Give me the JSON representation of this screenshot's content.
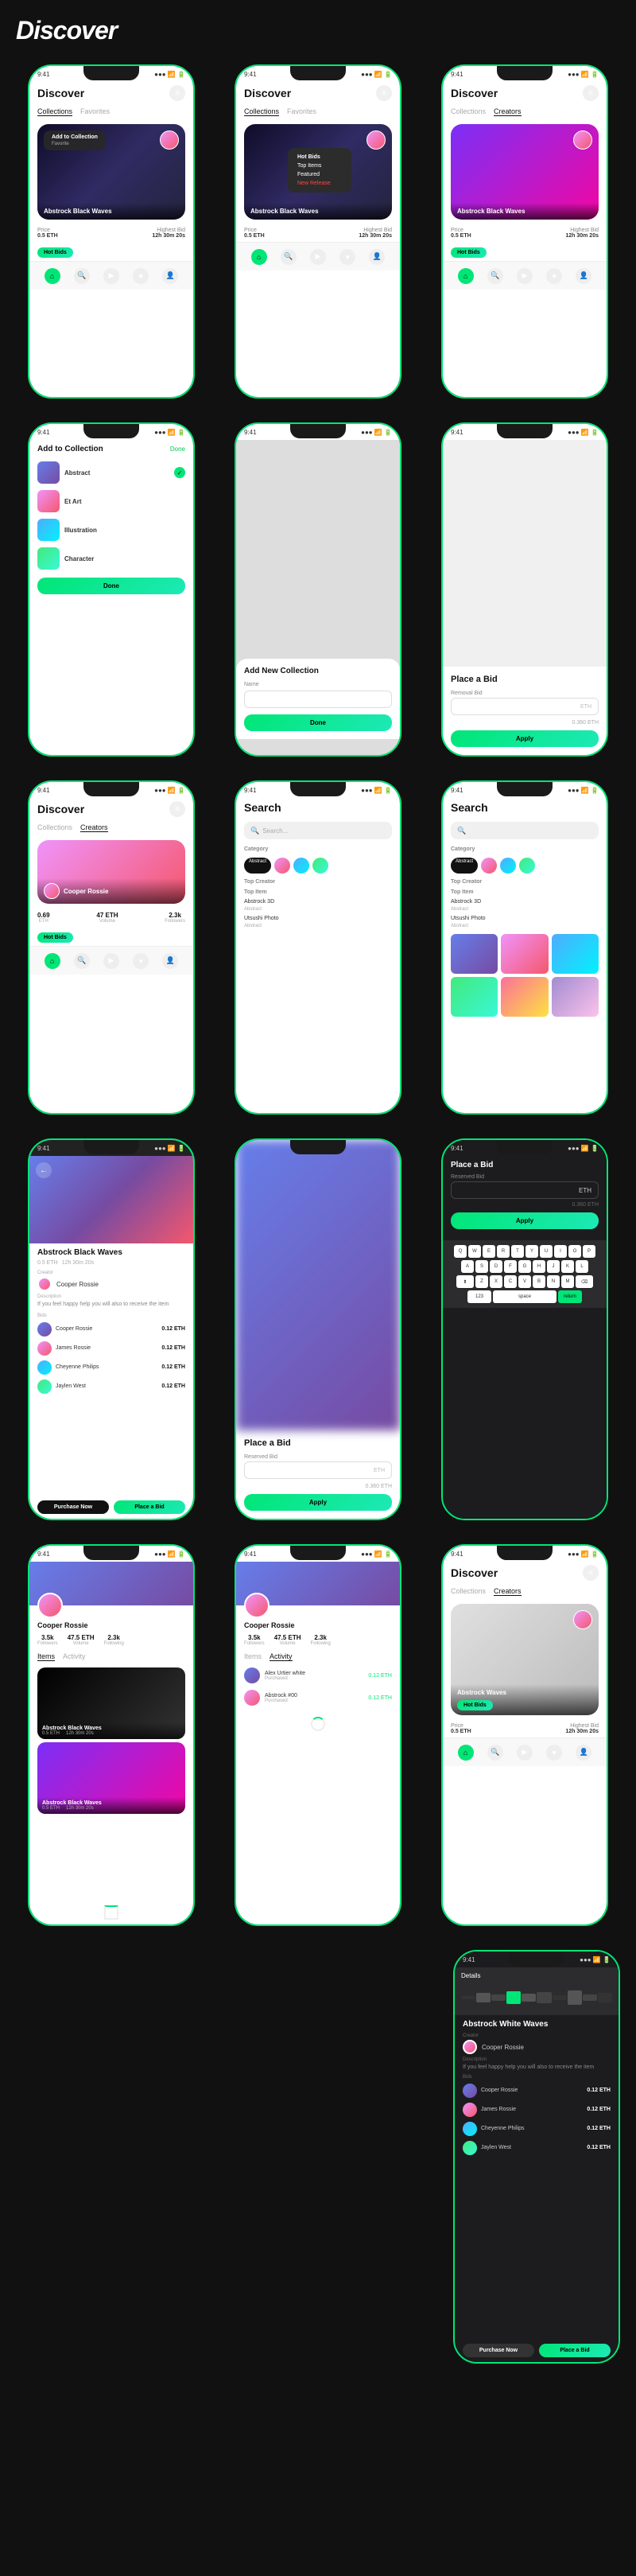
{
  "title": "Discover",
  "accent": "#00e676",
  "rows": [
    {
      "id": "row1",
      "phones": [
        {
          "id": "p1",
          "type": "discover-card",
          "header": "Discover",
          "tabs": [
            "Collections",
            "Favorites"
          ],
          "card": {
            "title": "Abstrock Black Waves",
            "gradient": "waves",
            "overlay": "Add to Collection"
          },
          "info": {
            "price": "0.5 ETH",
            "highbid": "12h 30m 20s"
          },
          "nav": [
            "home",
            "search",
            "play",
            "heart",
            "user"
          ]
        },
        {
          "id": "p2",
          "type": "discover-popup",
          "header": "Discover",
          "tabs": [
            "Collections",
            "Favorites"
          ],
          "card": {
            "title": "Abstrock Black Waves",
            "gradient": "waves"
          },
          "popup": [
            "Hot Bids",
            "Top Items",
            "Featured",
            "New Release"
          ],
          "info": {
            "price": "0.5 ETH",
            "highbid": "12h 30m 20s"
          }
        },
        {
          "id": "p3",
          "type": "discover-plain",
          "header": "Discover",
          "tabs": [
            "Collections",
            "Creators"
          ],
          "card": {
            "title": "Abstrock Black Waves",
            "gradient": "purple"
          },
          "info": {
            "price": "0.5 ETH",
            "highbid": "12h 30m 20s"
          }
        }
      ]
    },
    {
      "id": "row2",
      "phones": [
        {
          "id": "p4",
          "type": "collection-list",
          "header": "Add to Collection",
          "action": "Done",
          "items": [
            {
              "name": "Abstract",
              "gradient": "g1"
            },
            {
              "name": "Et Art",
              "gradient": "g2"
            },
            {
              "name": "Illustration",
              "gradient": "g3"
            },
            {
              "name": "Character",
              "gradient": "g4"
            }
          ],
          "doneBtn": "Done"
        },
        {
          "id": "p5",
          "type": "add-collection",
          "header": "Add New Collection",
          "inputLabel": "Name",
          "inputPlaceholder": "",
          "doneBtn": "Done"
        },
        {
          "id": "p6",
          "type": "place-bid-plain",
          "title": "Place a Bid",
          "reservedLabel": "Removal Bid",
          "reservedValue": "ETH",
          "yourBid": "0.360 ETH",
          "applyBtn": "Apply"
        }
      ]
    },
    {
      "id": "row3",
      "phones": [
        {
          "id": "p7",
          "type": "creators",
          "header": "Discover",
          "tabs": [
            "Collections",
            "Creators"
          ],
          "creator": {
            "name": "Cooper Rossie",
            "stats": {
              "left": "0.69",
              "mid": "47 ETH",
              "right": "2.3k"
            }
          },
          "hotBidsBtn": "Hot Bids"
        },
        {
          "id": "p8",
          "type": "search-empty",
          "header": "Search",
          "categories": [
            "Abstract",
            "Top Creator",
            "Top Item",
            "Abstrock 3D",
            "Utsushi Photo"
          ]
        },
        {
          "id": "p9",
          "type": "search-filled",
          "header": "Search",
          "categories": [
            "Abstract",
            "Top Creator",
            "Top Item",
            "Abstrock 3D",
            "Utsushi Photo"
          ],
          "gridItems": [
            "g1",
            "g2",
            "g3",
            "g4",
            "g5",
            "g6"
          ]
        }
      ]
    },
    {
      "id": "row4",
      "phones": [
        {
          "id": "p10",
          "type": "detail-full",
          "title": "Abstrock Black Waves",
          "creator": "Cooper Rossie",
          "price": "0.5 ETH",
          "highBid": "12h 30m 20s",
          "description": "If you feel happy help you will also to receive the item",
          "bids": [
            {
              "name": "Cooper Rossie",
              "amount": "0.12 ETH"
            },
            {
              "name": "James Rossie",
              "amount": "0.12 ETH"
            },
            {
              "name": "Cheyenne Philips",
              "amount": "0.12 ETH"
            },
            {
              "name": "Jaylen West",
              "amount": "0.12 ETH"
            }
          ],
          "purchaseBtn": "Purchase Now",
          "bidBtn": "Place a Bid"
        },
        {
          "id": "p11",
          "type": "place-bid-blur",
          "blurred": true,
          "title": "Place a Bid",
          "reservedLabel": "Reserved Bid",
          "reservedValue": "ETH",
          "yourBid": "0.360 ETH",
          "applyBtn": "Apply"
        },
        {
          "id": "p12",
          "type": "place-bid-keyboard",
          "title": "Place a Bid",
          "reservedLabel": "Reserved Bid",
          "reservedValue": "ETH",
          "yourBid": "0.360 ETH",
          "applyBtn": "Apply",
          "keyboard": [
            [
              "Q",
              "W",
              "E",
              "R",
              "T",
              "Y",
              "U",
              "I",
              "O",
              "P"
            ],
            [
              "A",
              "S",
              "D",
              "F",
              "G",
              "H",
              "J",
              "K",
              "L"
            ],
            [
              "Z",
              "X",
              "C",
              "V",
              "B",
              "N",
              "M"
            ]
          ]
        }
      ]
    },
    {
      "id": "row5",
      "phones": [
        {
          "id": "p13",
          "type": "profile-items",
          "name": "Cooper Rossie",
          "stats": [
            {
              "val": "3.5k",
              "label": "Followers"
            },
            {
              "val": "47.5 ETH",
              "label": "Volume"
            },
            {
              "val": "2.3k",
              "label": "Following"
            }
          ],
          "tabs": [
            "Items",
            "Activity"
          ],
          "nftItems": [
            {
              "name": "Abstrock Black Waves",
              "price": "0.5 ETH",
              "bid": "12h 30m 20s",
              "gradient": "g1"
            },
            {
              "name": "Abstrock Black Waves",
              "price": "0.5 ETH",
              "bid": "12h 30m 20s",
              "gradient": "purple"
            }
          ]
        },
        {
          "id": "p14",
          "type": "profile-activity",
          "name": "Cooper Rossie",
          "stats": [
            {
              "val": "3.5k",
              "label": "Followers"
            },
            {
              "val": "47.5 ETH",
              "label": "Volume"
            },
            {
              "val": "2.3k",
              "label": "Following"
            }
          ],
          "tabs": [
            "Items",
            "Activity"
          ],
          "activities": [
            {
              "name": "Alex Urtier white",
              "amount": "0.12 ETH"
            },
            {
              "name": "Abstrock #00",
              "amount": "0.12 ETH"
            }
          ]
        },
        {
          "id": "p15",
          "type": "discover-hot",
          "header": "Discover",
          "tabs": [
            "Collections",
            "Creators"
          ],
          "card": {
            "title": "Abstrock Waves",
            "gradient": "waves",
            "badge": "Hot Bids"
          },
          "info": {
            "price": "0.5 ETH",
            "highbid": "12h 30m 20s"
          }
        }
      ]
    },
    {
      "id": "row6",
      "phones": [
        {
          "id": "p16",
          "type": "detail-dark",
          "title": "Abstrock White Waves",
          "creator": "Cooper Rossie",
          "description": "If you feel happy help you will also to receive the item",
          "bids": [
            {
              "name": "Cooper Rossie",
              "amount": "0.12 ETH"
            },
            {
              "name": "James Rossie",
              "amount": "0.12 ETH"
            },
            {
              "name": "Cheyenne Philips",
              "amount": "0.12 ETH"
            },
            {
              "name": "Jaylen West",
              "amount": "0.12 ETH"
            }
          ],
          "purchaseBtn": "Purchase Now",
          "bidBtn": "Place a Bid"
        }
      ]
    }
  ]
}
